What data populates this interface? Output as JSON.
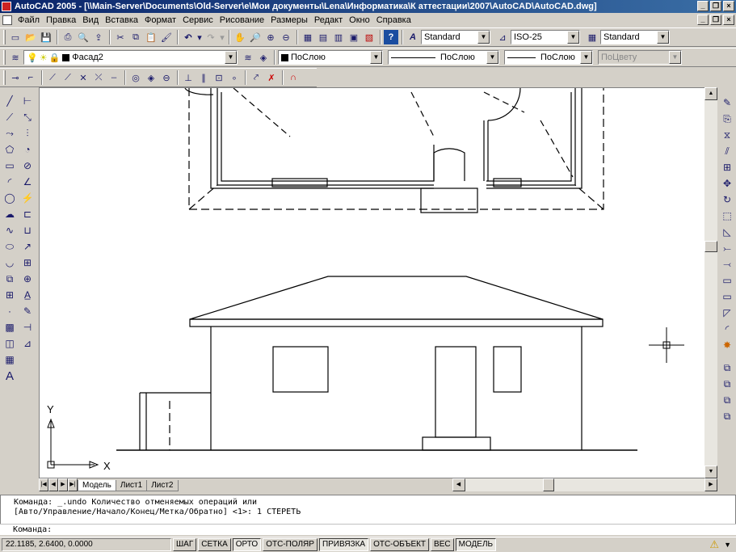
{
  "title": "AutoCAD 2005 - [\\\\Main-Server\\Documents\\Old-Server\\e\\Мои документы\\Lena\\Информатика\\К аттестации\\2007\\AutoCAD\\AutoCAD.dwg]",
  "menu": [
    "Файл",
    "Правка",
    "Вид",
    "Вставка",
    "Формат",
    "Сервис",
    "Рисование",
    "Размеры",
    "Редакт",
    "Окно",
    "Справка"
  ],
  "window_buttons": {
    "minimize": "_",
    "restore": "❐",
    "close": "×"
  },
  "styles": {
    "text_style": "Standard",
    "dim_style": "ISO-25",
    "table_style": "Standard"
  },
  "layers": {
    "current_layer": "Фасад2",
    "color": "ПоСлою",
    "linetype": "ПоСлою",
    "lineweight": "ПоСлою",
    "plotstyle": "ПоЦвету"
  },
  "tabs": [
    "Модель",
    "Лист1",
    "Лист2"
  ],
  "command_history": [
    "Команда: _.undo Количество отменяемых операций или",
    "[Авто/Управление/Начало/Конец/Метка/Обратно] <1>: 1 СТЕРЕТЬ"
  ],
  "command_prompt": "Команда:",
  "coordinates": "22.1185, 2.6400, 0.0000",
  "status_buttons": [
    {
      "label": "ШАГ",
      "on": false
    },
    {
      "label": "СЕТКА",
      "on": false
    },
    {
      "label": "ОРТО",
      "on": true
    },
    {
      "label": "ОТС-ПОЛЯР",
      "on": false
    },
    {
      "label": "ПРИВЯЗКА",
      "on": true
    },
    {
      "label": "ОТС-ОБЪЕКТ",
      "on": false
    },
    {
      "label": "ВЕС",
      "on": false
    },
    {
      "label": "МОДЕЛЬ",
      "on": true
    }
  ],
  "ucs": {
    "x_label": "X",
    "y_label": "Y"
  },
  "icons": [
    "new-icon",
    "open-icon",
    "save-icon",
    "print-icon",
    "preview-icon",
    "publish-icon",
    "cut-icon",
    "copy-icon",
    "paste-icon",
    "matchprop-icon",
    "undo-icon",
    "redo-icon",
    "pan-icon",
    "zoom-realtime-icon",
    "zoom-window-icon",
    "zoom-previous-icon",
    "properties-icon",
    "designcenter-icon",
    "toolpalettes-icon",
    "dbconnect-icon",
    "markup-icon",
    "help-icon"
  ]
}
